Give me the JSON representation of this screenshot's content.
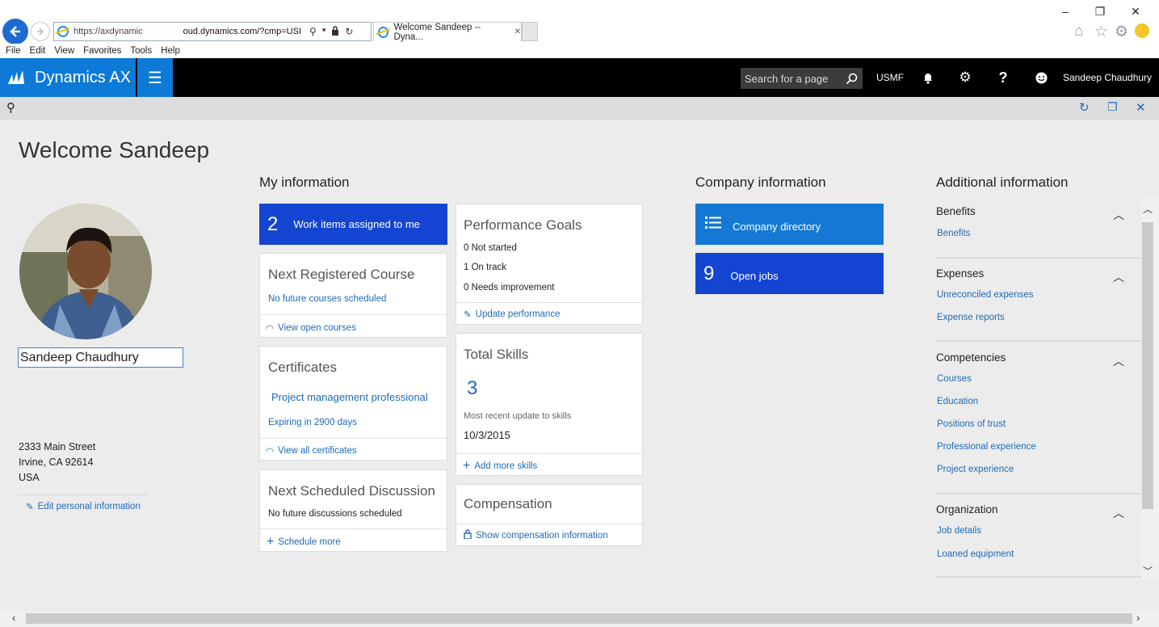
{
  "browser": {
    "url_prefix": "https://axdynamic",
    "url_host": "oud.dynamics.com/?cmp=USI",
    "tab_title": "Welcome Sandeep -- Dyna...",
    "tab_close": "✕",
    "menu": [
      "File",
      "Edit",
      "View",
      "Favorites",
      "Tools",
      "Help"
    ]
  },
  "app": {
    "brand": "Dynamics AX",
    "search_placeholder": "Search for a page",
    "company": "USMF",
    "user": "Sandeep Chaudhury"
  },
  "profile": {
    "welcome": "Welcome Sandeep",
    "name": "Sandeep Chaudhury",
    "address_line1": "2333 Main Street",
    "address_line2": "Irvine, CA 92614",
    "address_line3": "USA",
    "edit_link": "Edit personal information"
  },
  "my_info": {
    "title": "My information",
    "work_items": {
      "count": "2",
      "label": "Work items assigned to me"
    },
    "course": {
      "title": "Next Registered Course",
      "text": "No future courses scheduled",
      "link": "View open courses"
    },
    "certificates": {
      "title": "Certificates",
      "item": "Project management professional",
      "expiry": "Expiring in 2900 days",
      "link": "View all certificates"
    },
    "discussion": {
      "title": "Next Scheduled Discussion",
      "text": "No future discussions scheduled",
      "link": "Schedule more"
    },
    "goals": {
      "title": "Performance Goals",
      "not_started": "0 Not started",
      "on_track": "1 On track",
      "needs_improvement": "0 Needs improvement",
      "link": "Update performance"
    },
    "skills": {
      "title": "Total Skills",
      "count": "3",
      "caption": "Most recent update to skills",
      "date": "10/3/2015",
      "link": "Add more skills"
    },
    "compensation": {
      "title": "Compensation",
      "link": "Show compensation information"
    }
  },
  "company_info": {
    "title": "Company information",
    "directory": "Company directory",
    "jobs": {
      "count": "9",
      "label": "Open jobs"
    }
  },
  "additional": {
    "title": "Additional information",
    "benefits": {
      "head": "Benefits",
      "links": [
        "Benefits"
      ]
    },
    "expenses": {
      "head": "Expenses",
      "links": [
        "Unreconciled expenses",
        "Expense reports"
      ]
    },
    "competencies": {
      "head": "Competencies",
      "links": [
        "Courses",
        "Education",
        "Positions of trust",
        "Professional experience",
        "Project experience"
      ]
    },
    "organization": {
      "head": "Organization",
      "links": [
        "Job details",
        "Loaned equipment"
      ]
    }
  },
  "colors": {
    "accent": "#0c7ad6",
    "tile_dark": "#1445d2",
    "tile_light": "#1478d4",
    "link": "#1e6bb8"
  }
}
